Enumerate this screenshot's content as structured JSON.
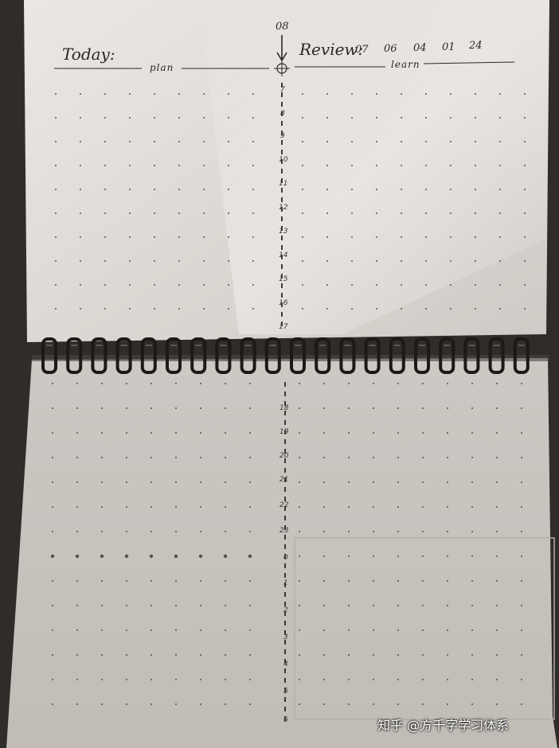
{
  "header": {
    "today_label": "Today:",
    "plan_label": "plan",
    "review_label": "Review:",
    "learn_label": "learn",
    "review_numbers": [
      "07",
      "06",
      "04",
      "01",
      "24"
    ],
    "timeline_start": "08"
  },
  "timeline": {
    "upper_hours": [
      "7",
      "8",
      "9",
      "10",
      "11",
      "12",
      "13",
      "14",
      "15",
      "16",
      "17"
    ],
    "lower_hours": [
      "18",
      "19",
      "20",
      "21",
      "22",
      "23",
      "0",
      "1",
      "2",
      "3",
      "4",
      "5",
      "6"
    ]
  },
  "watermark": "知乎 @方千字学习体系",
  "colors": {
    "background": "#2f2c2a",
    "upper_page": "#e6e2dd",
    "lower_page": "#c9c4bf",
    "ink": "#2a2725",
    "spiral": "#1b1a19"
  }
}
